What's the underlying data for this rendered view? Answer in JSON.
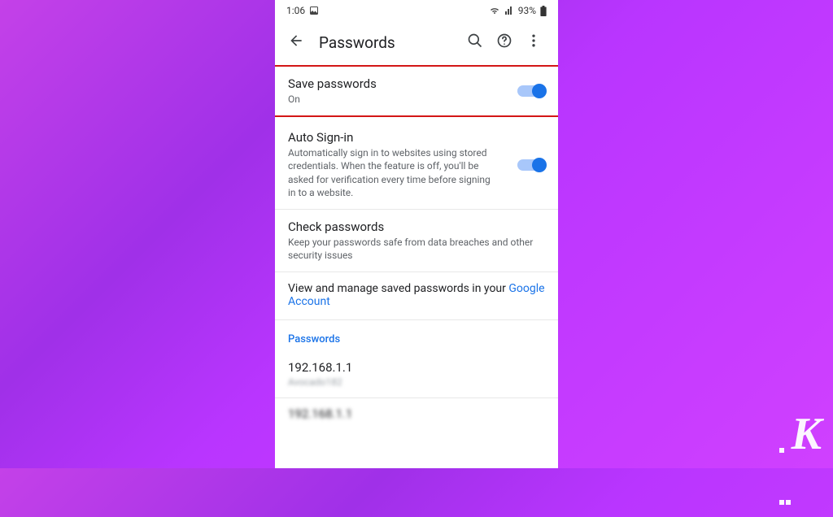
{
  "status": {
    "time": "1:06",
    "battery": "93%"
  },
  "appbar": {
    "title": "Passwords"
  },
  "rows": {
    "save": {
      "title": "Save passwords",
      "sub": "On"
    },
    "autosignin": {
      "title": "Auto Sign-in",
      "sub": "Automatically sign in to websites using stored credentials. When the feature is off, you'll be asked for verification every time before signing in to a website."
    },
    "check": {
      "title": "Check passwords",
      "sub": "Keep your passwords safe from data breaches and other security issues"
    },
    "manage": {
      "text": "View and manage saved passwords in your ",
      "link": "Google Account"
    }
  },
  "section_header": "Passwords",
  "passwords": [
    {
      "site": "192.168.1.1",
      "user": "Avocado182"
    },
    {
      "site": "192.168.1.1",
      "user": ""
    }
  ],
  "watermark": "K"
}
